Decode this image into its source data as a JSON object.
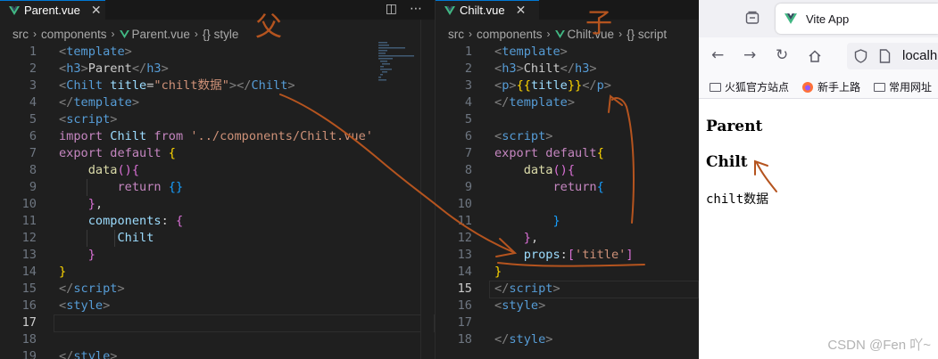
{
  "left_editor": {
    "tab": {
      "filename": "Parent.vue"
    },
    "breadcrumb": [
      "src",
      "components",
      "Parent.vue",
      "{} style"
    ],
    "lines": [
      {
        "n": "1",
        "html": "<span class='tg'>&lt;</span><span class='k'>template</span><span class='tg'>&gt;</span>"
      },
      {
        "n": "2",
        "html": "<span class='tg'>&lt;</span><span class='k'>h3</span><span class='tg'>&gt;</span>Parent<span class='tg'>&lt;/</span><span class='k'>h3</span><span class='tg'>&gt;</span>"
      },
      {
        "n": "3",
        "html": "<span class='tg'>&lt;</span><span class='k'>Chilt</span> <span class='a'>title</span>=<span class='s'>\"chilt数据\"</span><span class='tg'>&gt;&lt;/</span><span class='k'>Chilt</span><span class='tg'>&gt;</span>"
      },
      {
        "n": "4",
        "html": "<span class='tg'>&lt;/</span><span class='k'>template</span><span class='tg'>&gt;</span>"
      },
      {
        "n": "5",
        "html": "<span class='tg'>&lt;</span><span class='k'>script</span><span class='tg'>&gt;</span>"
      },
      {
        "n": "6",
        "html": "<span class='kp'>import</span> <span class='a'>Chilt</span> <span class='kp'>from</span> <span class='s'>'../components/Chilt.vue'</span>"
      },
      {
        "n": "7",
        "html": "<span class='kp'>export</span> <span class='kp'>default</span> <span class='b1'>{</span>"
      },
      {
        "n": "8",
        "html": "    <span class='fn'>data</span><span class='b2'>()</span><span class='b2'>{</span>"
      },
      {
        "n": "9",
        "html": "        <span class='kp'>return</span> <span class='b3'>{}</span>"
      },
      {
        "n": "10",
        "html": "    <span class='b2'>}</span>,"
      },
      {
        "n": "11",
        "html": "    <span class='a'>components</span>: <span class='b2'>{</span>"
      },
      {
        "n": "12",
        "html": "        <span class='a'>Chilt</span>"
      },
      {
        "n": "13",
        "html": "    <span class='b2'>}</span>"
      },
      {
        "n": "14",
        "html": "<span class='b1'>}</span>"
      },
      {
        "n": "15",
        "html": "<span class='tg'>&lt;/</span><span class='k'>script</span><span class='tg'>&gt;</span>"
      },
      {
        "n": "16",
        "html": "<span class='tg'>&lt;</span><span class='k'>style</span><span class='tg'>&gt;</span>"
      },
      {
        "n": "17",
        "html": ""
      },
      {
        "n": "18",
        "html": ""
      },
      {
        "n": "19",
        "html": "<span class='tg'>&lt;/</span><span class='k'>style</span><span class='tg'>&gt;</span>"
      }
    ],
    "active_line": "17",
    "annotation": "父"
  },
  "right_editor": {
    "tab": {
      "filename": "Chilt.vue"
    },
    "breadcrumb": [
      "src",
      "components",
      "Chilt.vue",
      "{} script"
    ],
    "lines": [
      {
        "n": "1",
        "html": "<span class='tg'>&lt;</span><span class='k'>template</span><span class='tg'>&gt;</span>"
      },
      {
        "n": "2",
        "html": "<span class='tg'>&lt;</span><span class='k'>h3</span><span class='tg'>&gt;</span>Chilt<span class='tg'>&lt;/</span><span class='k'>h3</span><span class='tg'>&gt;</span>"
      },
      {
        "n": "3",
        "html": "<span class='tg'>&lt;</span><span class='k'>p</span><span class='tg'>&gt;</span><span class='b1'>{{</span><span class='a'>title</span><span class='b1'>}}</span><span class='tg'>&lt;/</span><span class='k'>p</span><span class='tg'>&gt;</span>"
      },
      {
        "n": "4",
        "html": "<span class='tg'>&lt;/</span><span class='k'>template</span><span class='tg'>&gt;</span>"
      },
      {
        "n": "5",
        "html": ""
      },
      {
        "n": "6",
        "html": "<span class='tg'>&lt;</span><span class='k'>script</span><span class='tg'>&gt;</span>"
      },
      {
        "n": "7",
        "html": "<span class='kp'>export</span> <span class='kp'>default</span><span class='b1'>{</span>"
      },
      {
        "n": "8",
        "html": "    <span class='fn'>data</span><span class='b2'>()</span><span class='b2'>{</span>"
      },
      {
        "n": "9",
        "html": "        <span class='kp'>return</span><span class='b3'>{</span>"
      },
      {
        "n": "10",
        "html": ""
      },
      {
        "n": "11",
        "html": "        <span class='b3'>}</span>"
      },
      {
        "n": "12",
        "html": "    <span class='b2'>}</span>,"
      },
      {
        "n": "13",
        "html": "    <span class='a'>props</span>:<span class='b2'>[</span><span class='s'>'title'</span><span class='b2'>]</span>"
      },
      {
        "n": "14",
        "html": "<span class='b1'>}</span>"
      },
      {
        "n": "15",
        "html": "<span class='tg'>&lt;/</span><span class='k'>script</span><span class='tg'>&gt;</span>"
      },
      {
        "n": "16",
        "html": "<span class='tg'>&lt;</span><span class='k'>style</span><span class='tg'>&gt;</span>"
      },
      {
        "n": "17",
        "html": ""
      },
      {
        "n": "18",
        "html": "<span class='tg'>&lt;/</span><span class='k'>style</span><span class='tg'>&gt;</span>"
      }
    ],
    "active_line": "15",
    "annotation": "子"
  },
  "browser": {
    "tab_title": "Vite App",
    "url": "localh",
    "bookmarks": [
      "火狐官方站点",
      "新手上路",
      "常用网址"
    ],
    "page": {
      "h3_parent": "Parent",
      "h3_child": "Chilt",
      "p_text": "chilt数据"
    }
  },
  "watermark": "CSDN @Fen 吖~",
  "colors": {
    "accent": "#0078d4",
    "annotation": "#b5541f",
    "vue_green": "#41b883"
  }
}
